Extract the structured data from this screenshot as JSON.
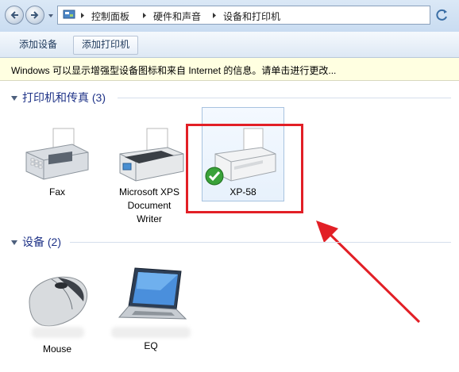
{
  "address": {
    "breadcrumbs": [
      "控制面板",
      "硬件和声音",
      "设备和打印机"
    ]
  },
  "toolbar": {
    "add_device": "添加设备",
    "add_printer": "添加打印机"
  },
  "infobar": {
    "text": "Windows 可以显示增强型设备图标和来自 Internet 的信息。请单击进行更改..."
  },
  "printers_group": {
    "title": "打印机和传真 (3)",
    "items": [
      {
        "label": "Fax"
      },
      {
        "label_lines": [
          "Microsoft XPS",
          "Document",
          "Writer"
        ]
      },
      {
        "label": "XP-58",
        "default": true
      }
    ]
  },
  "devices_group": {
    "title": "设备 (2)",
    "items": [
      {
        "label": "Mouse"
      },
      {
        "label": "EQ"
      }
    ]
  },
  "colors": {
    "highlight_border": "#e21f26",
    "group_title": "#1e3287",
    "info_bar_bg": "#ffffe1"
  }
}
